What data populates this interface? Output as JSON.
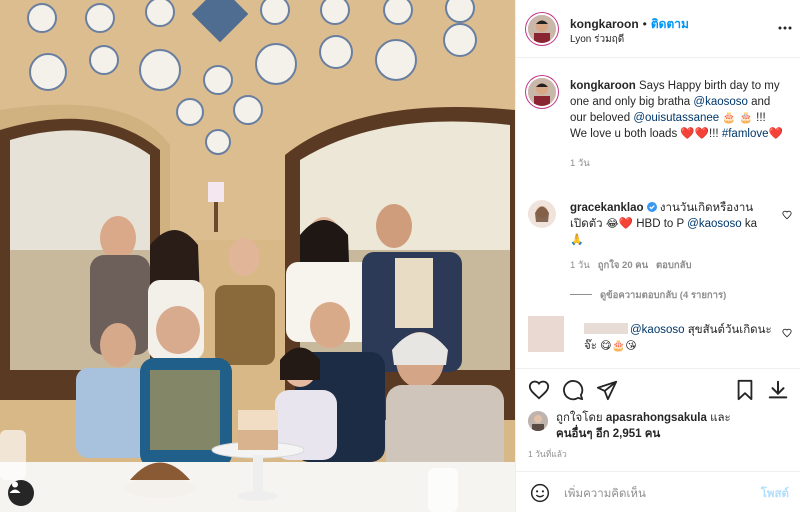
{
  "post": {
    "username": "kongkaroon",
    "follow_label": "ติดตาม",
    "location": "Lyon ร่วมฤดี"
  },
  "caption": {
    "username": "kongkaroon",
    "text_1": "Says Happy birth day to my one and only big bratha",
    "mention_1": "@kaososo",
    "text_2": "and our beloved",
    "mention_2": "@ouisutassanee",
    "text_3": "!!! We love u both loads",
    "text_4": "!!!",
    "hashtag": "#famlove",
    "time": "1 วัน"
  },
  "comments": [
    {
      "username": "gracekanklao",
      "text_1": "งานวันเกิดหรืองานเปิดตัว",
      "text_2": "HBD to P",
      "mention": "@kaososo",
      "text_3": "ka",
      "time": "1 วัน",
      "likes": "ถูกใจ 20 คน",
      "reply": "ตอบกลับ",
      "view_replies": "ดูข้อความตอบกลับ (4 รายการ)"
    },
    {
      "mention": "@kaososo",
      "text": "สุขสันต์วันเกิดนะจ๊ะ"
    }
  ],
  "likes": {
    "prefix": "ถูกใจโดย",
    "user": "apasrahongsakula",
    "suffix": "และ",
    "others": "คนอื่นๆ อีก 2,951 คน"
  },
  "post_date": "1 วันที่แล้ว",
  "add_comment": {
    "placeholder": "เพิ่มความคิดเห็น",
    "post_label": "โพสต์"
  },
  "colors": {
    "link": "#00376b",
    "follow": "#0095f6",
    "heart": "#ed4956",
    "verified": "#3897f0"
  }
}
